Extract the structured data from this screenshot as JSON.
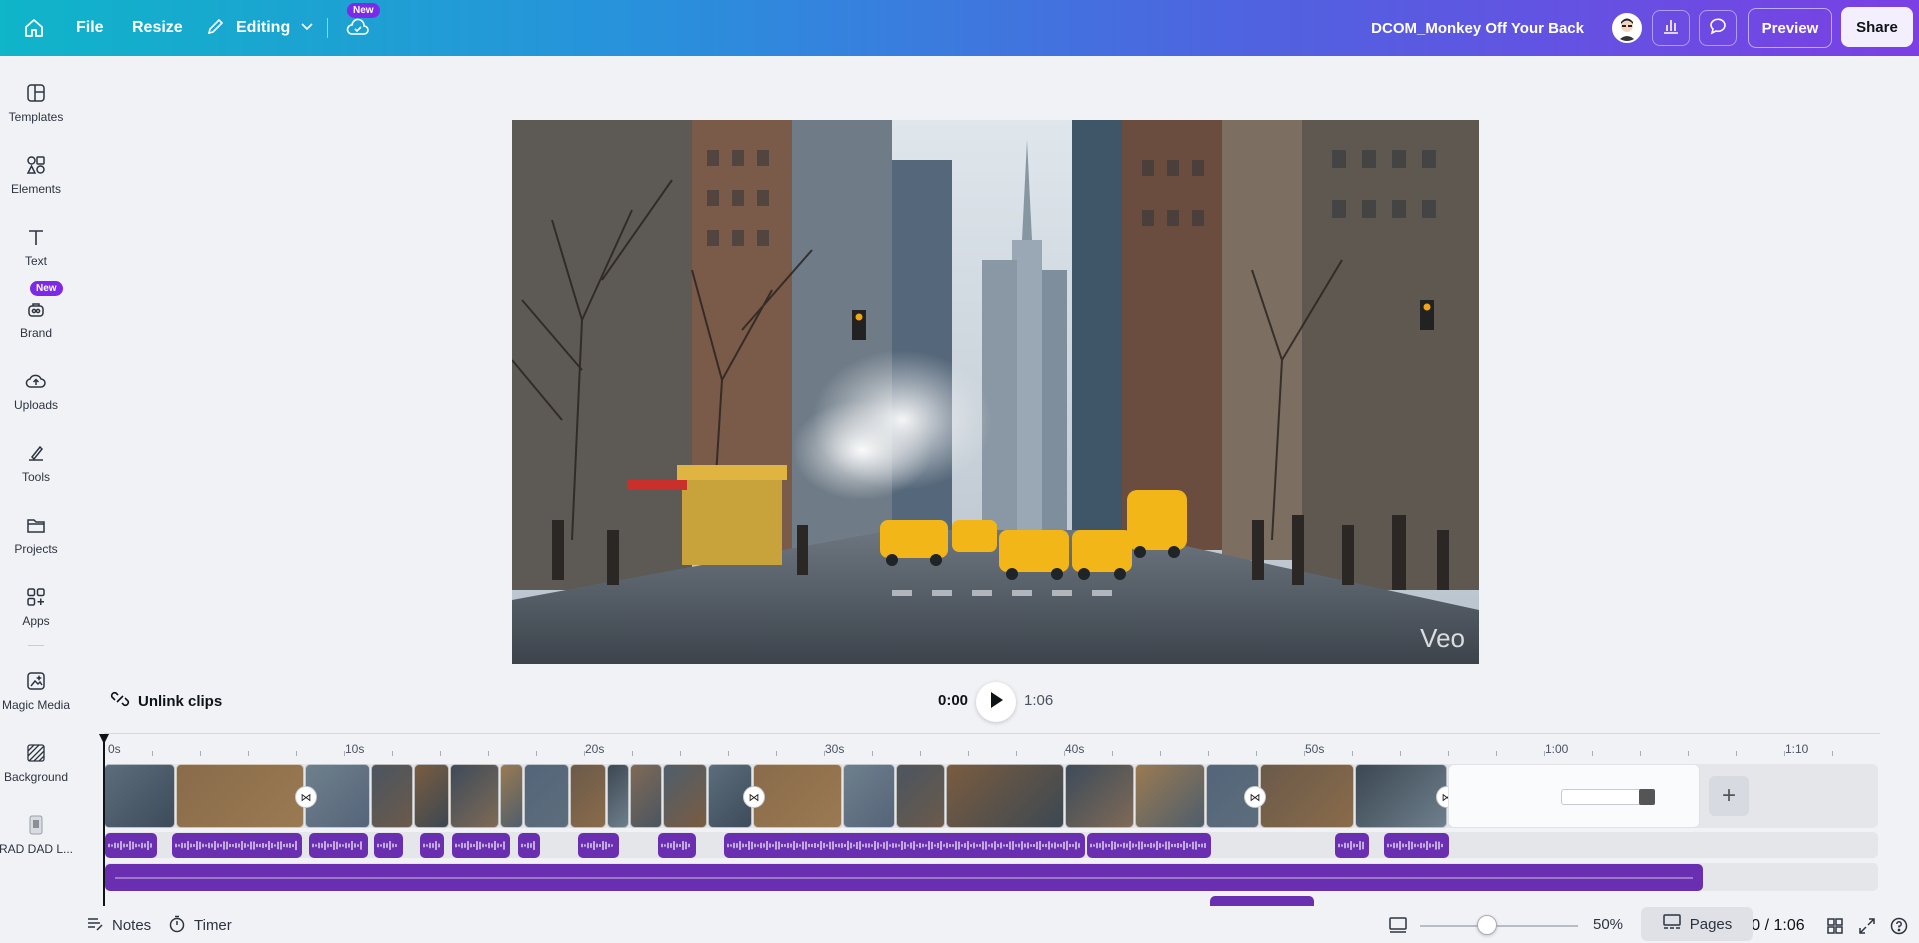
{
  "topbar": {
    "file_label": "File",
    "resize_label": "Resize",
    "editing_label": "Editing",
    "new_badge": "New",
    "doc_title": "DCOM_Monkey Off Your Back",
    "preview_label": "Preview",
    "share_label": "Share",
    "icons": [
      "home-icon",
      "pencil-icon",
      "chevron-down-icon",
      "cloud-check-icon",
      "insights-icon",
      "comment-icon"
    ]
  },
  "sidebar": {
    "items": [
      {
        "label": "Templates",
        "icon": "templates-icon"
      },
      {
        "label": "Elements",
        "icon": "elements-icon"
      },
      {
        "label": "Text",
        "icon": "text-icon"
      },
      {
        "label": "Brand",
        "icon": "brand-icon",
        "badge": "New"
      },
      {
        "label": "Uploads",
        "icon": "upload-icon"
      },
      {
        "label": "Tools",
        "icon": "tools-icon"
      },
      {
        "label": "Projects",
        "icon": "folder-icon"
      },
      {
        "label": "Apps",
        "icon": "apps-icon"
      },
      {
        "label": "Magic Media",
        "icon": "magic-media-icon"
      },
      {
        "label": "Background",
        "icon": "background-icon"
      },
      {
        "label": "RAD DAD L...",
        "icon": "project-thumb-icon"
      }
    ]
  },
  "canvas": {
    "watermark": "Veo"
  },
  "playback": {
    "unlink_label": "Unlink clips",
    "current_time": "0:00",
    "total_time": "1:06"
  },
  "timeline": {
    "ruler_labels": [
      "0s",
      "10s",
      "20s",
      "30s",
      "40s",
      "50s",
      "1:00",
      "1:10"
    ]
  },
  "footer": {
    "notes_label": "Notes",
    "timer_label": "Timer",
    "zoom_value": "50%",
    "pages_label": "Pages",
    "time_readout": "0:00 / 1:06"
  },
  "colors": {
    "accent_purple": "#7d2ae8",
    "audio_purple": "#6a2fb0",
    "topbar_start": "#0fb5c9",
    "topbar_end": "#7b3fe4"
  }
}
